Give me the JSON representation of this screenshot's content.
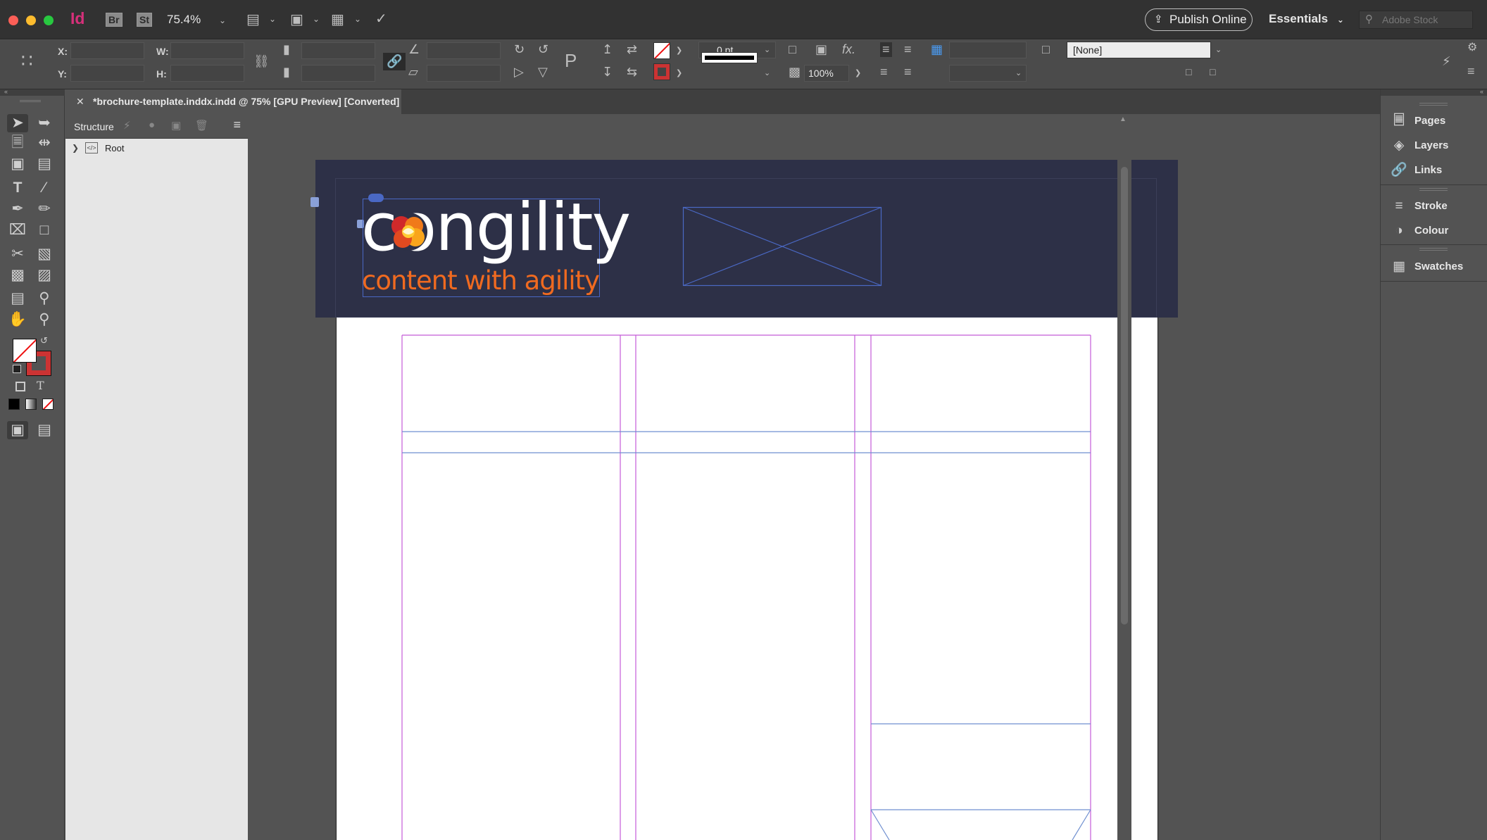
{
  "appbar": {
    "app_logo": "Id",
    "bridge": "Br",
    "stock_app": "St",
    "zoom": "75.4%",
    "publish_label": "Publish Online",
    "workspace": "Essentials",
    "search_placeholder": "Adobe Stock"
  },
  "control": {
    "x_label": "X:",
    "y_label": "Y:",
    "w_label": "W:",
    "h_label": "H:",
    "stroke_weight": "0 pt",
    "opacity": "100%",
    "object_style": "[None]"
  },
  "tab": {
    "title": "*brochure-template.inddx.indd @ 75% [GPU Preview] [Converted]"
  },
  "structure": {
    "title": "Structure",
    "root_label": "Root"
  },
  "document": {
    "logo_word": "congility",
    "logo_tagline": "content with agility",
    "colors": {
      "header_band": "#2d3047",
      "tagline": "#f06a20",
      "margin_guide": "#c45ad8",
      "frame_edge": "#4a68c4"
    }
  },
  "panels": [
    {
      "label": "Pages",
      "icon": "pages-icon"
    },
    {
      "label": "Layers",
      "icon": "layers-icon"
    },
    {
      "label": "Links",
      "icon": "links-icon"
    },
    {
      "label": "Stroke",
      "icon": "stroke-icon"
    },
    {
      "label": "Colour",
      "icon": "colour-icon"
    },
    {
      "label": "Swatches",
      "icon": "swatches-icon"
    }
  ]
}
